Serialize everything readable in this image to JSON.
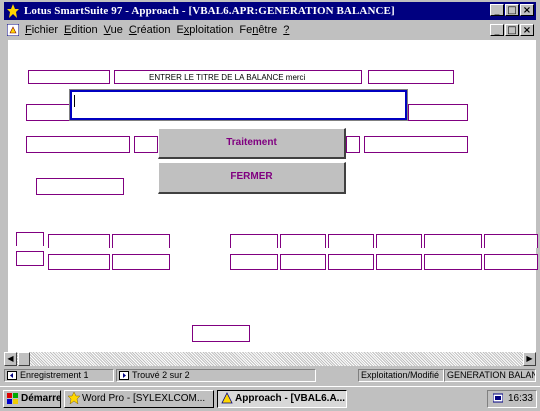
{
  "window": {
    "title": "Lotus SmartSuite 97   - Approach - [VBAL6.APR:GENERATION BALANCE]",
    "controls": [
      "_",
      "□",
      "×"
    ]
  },
  "menu": {
    "items": [
      {
        "accel": "F",
        "rest": "ichier"
      },
      {
        "accel": "E",
        "rest": "dition"
      },
      {
        "accel": "V",
        "rest": "ue"
      },
      {
        "accel": "C",
        "rest": "réation"
      },
      {
        "accel": "x",
        "pre": "E",
        "rest": "ploitation"
      },
      {
        "accel": "n",
        "pre": "Fe",
        "rest": "être"
      },
      {
        "accel": "?",
        "rest": ""
      }
    ]
  },
  "form": {
    "prompt_label": "ENTRER LE TITRE DE LA BALANCE  merci",
    "title_input_value": "",
    "traitement_button": "Traitement",
    "fermer_button": "FERMER"
  },
  "status": {
    "record": "Enregistrement 1",
    "found": "Trouvé 2 sur 2",
    "mode": "Exploitation/Modifié",
    "view": "GENERATION BALANCE"
  },
  "taskbar": {
    "start": "Démarrer",
    "task1": "Word Pro - [SYLEXLCOM...",
    "task2": "Approach - [VBAL6.A...",
    "clock": "16:33"
  },
  "colors": {
    "titlebar": "#000080",
    "field_border": "#800080",
    "input_border": "#0000c0",
    "button_text": "#800080"
  }
}
